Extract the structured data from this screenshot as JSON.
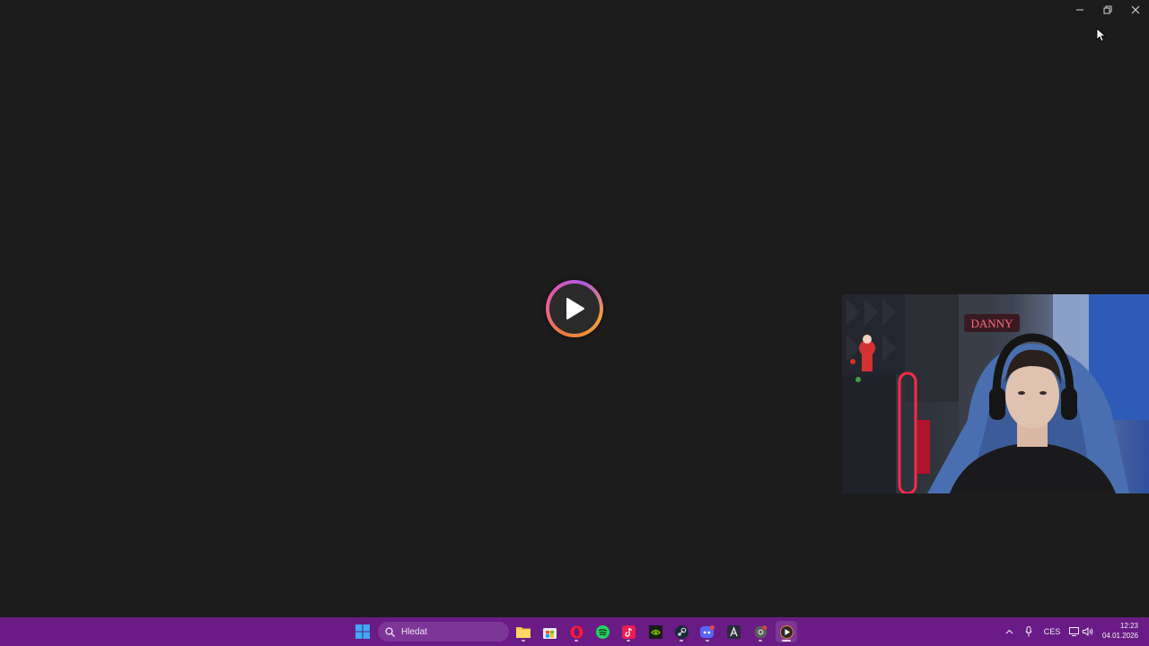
{
  "window": {
    "minimize_icon": "minimize-icon",
    "restore_icon": "restore-icon",
    "close_icon": "close-icon"
  },
  "player": {
    "play_icon": "play-icon",
    "ring_colors": [
      "#f07c3c",
      "#e85aa0",
      "#b05ae0"
    ]
  },
  "webcam": {
    "sign_text": "DANNY"
  },
  "taskbar": {
    "background": "#6a1b86",
    "search_placeholder": "Hledat",
    "pinned_apps": [
      "start-icon",
      "file-explorer-icon",
      "microsoft-store-icon",
      "opera-icon",
      "spotify-icon",
      "tiktok-icon",
      "nvidia-icon",
      "steam-icon",
      "discord-icon",
      "obs-icon",
      "chrome-icon",
      "media-player-icon"
    ],
    "tray": {
      "language": "CES",
      "time": "12:23",
      "date": "04.01.2026"
    }
  }
}
